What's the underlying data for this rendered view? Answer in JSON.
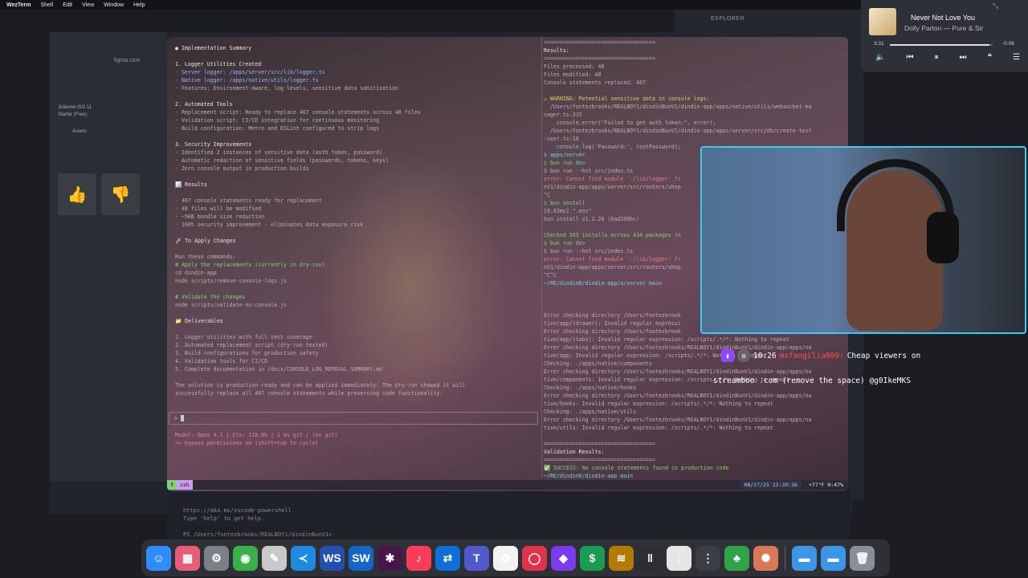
{
  "menubar": {
    "app": "WezTerm",
    "items": [
      "Shell",
      "Edit",
      "View",
      "Window",
      "Help"
    ]
  },
  "background": {
    "figma_tab": "figma.com",
    "user_name": "Julianne ISO 11",
    "user_sub": "Starter (Free)",
    "assets_tab": "Assets",
    "explorer_label": "EXPLORER",
    "terminal_lines": [
      "https://aka.ms/vscode-powershell",
      "Type 'help' to get help.",
      "",
      "PS /Users/fontezbrooks/REALBOY1/dindinBunV1>"
    ]
  },
  "terminal": {
    "left_lines": [
      {
        "t": "● Implementation Summary",
        "c": "hd"
      },
      {
        "t": "",
        "c": ""
      },
      {
        "t": "1. Logger Utilities Created",
        "c": "hd"
      },
      {
        "t": "- Server logger: /apps/server/src/lib/logger.ts",
        "c": "blue"
      },
      {
        "t": "- Native logger: /apps/native/utils/logger.ts",
        "c": "blue"
      },
      {
        "t": "- Features: Environment-aware, log levels, sensitive data sanitization",
        "c": "muted"
      },
      {
        "t": "",
        "c": ""
      },
      {
        "t": "2. Automated Tools",
        "c": "hd"
      },
      {
        "t": "- Replacement script: Ready to replace 467 console statements across 48 files",
        "c": "muted"
      },
      {
        "t": "- Validation script: CI/CD integration for continuous monitoring",
        "c": "muted"
      },
      {
        "t": "- Build configuration: Metro and ESLint configured to strip logs",
        "c": "muted"
      },
      {
        "t": "",
        "c": ""
      },
      {
        "t": "3. Security Improvements",
        "c": "hd"
      },
      {
        "t": "- Identified 2 instances of sensitive data (auth token, password)",
        "c": "muted"
      },
      {
        "t": "- Automatic redaction of sensitive fields (passwords, tokens, keys)",
        "c": "muted"
      },
      {
        "t": "- Zero console output in production builds",
        "c": "muted"
      },
      {
        "t": "",
        "c": ""
      },
      {
        "t": "📊 Results",
        "c": "hd"
      },
      {
        "t": "",
        "c": ""
      },
      {
        "t": "- 467 console statements ready for replacement",
        "c": "muted"
      },
      {
        "t": "- 48 files will be modified",
        "c": "muted"
      },
      {
        "t": "- ~5KB bundle size reduction",
        "c": "muted"
      },
      {
        "t": "- 100% security improvement - eliminates data exposure risk",
        "c": "muted"
      },
      {
        "t": "",
        "c": ""
      },
      {
        "t": "🚀 To Apply Changes",
        "c": "hd"
      },
      {
        "t": "",
        "c": ""
      },
      {
        "t": "Run these commands:",
        "c": "muted"
      },
      {
        "t": "# Apply the replacements (currently in dry-run)",
        "c": "green"
      },
      {
        "t": "cd dindin-app",
        "c": "muted"
      },
      {
        "t": "node scripts/remove-console-logs.js",
        "c": "muted"
      },
      {
        "t": "",
        "c": ""
      },
      {
        "t": "# Validate the changes",
        "c": "green"
      },
      {
        "t": "node scripts/validate-no-console.js",
        "c": "muted"
      },
      {
        "t": "",
        "c": ""
      },
      {
        "t": "📁 Deliverables",
        "c": "hd"
      },
      {
        "t": "",
        "c": ""
      },
      {
        "t": "1. Logger utilities with full test coverage",
        "c": "muted"
      },
      {
        "t": "2. Automated replacement script (dry-run tested)",
        "c": "muted"
      },
      {
        "t": "3. Build configurations for production safety",
        "c": "muted"
      },
      {
        "t": "4. Validation tools for CI/CD",
        "c": "muted"
      },
      {
        "t": "5. Complete documentation in /docs/CONSOLE_LOG_REMOVAL_SUMMARY.md",
        "c": "muted"
      },
      {
        "t": "",
        "c": ""
      },
      {
        "t": "The solution is production-ready and can be applied immediately. The dry-run showed it will",
        "c": "muted"
      },
      {
        "t": "successfully replace all 467 console statements while preserving code functionality.",
        "c": "muted"
      }
    ],
    "prompt_text": "> ",
    "model_line": "Model: Opus 4.1 | Ctx: 116.0k | 1 ms git | (no git)",
    "bypass_line": ">> bypass permissions on (shift+tab to cycle)",
    "right_lines": [
      {
        "t": "===================================",
        "c": "muted"
      },
      {
        "t": "Results:",
        "c": "hd"
      },
      {
        "t": "===================================",
        "c": "muted"
      },
      {
        "t": "Files processed: 48",
        "c": "muted"
      },
      {
        "t": "Files modified: 48",
        "c": "muted"
      },
      {
        "t": "Console statements replaced: 467",
        "c": "muted"
      },
      {
        "t": "",
        "c": ""
      },
      {
        "t": "⚠ WARNING: Potential sensitive data in console logs:",
        "c": "yellow"
      },
      {
        "t": "  /Users/fontezbrooks/REALBOY1/dindinBunV1/dindin-app/apps/native/utils/websocket-ma",
        "c": "muted"
      },
      {
        "t": "nager.ts:315",
        "c": "muted"
      },
      {
        "t": "    console.error(\"Failed to get auth token:\", error);",
        "c": "muted"
      },
      {
        "t": "  /Users/fontezbrooks/REALBOY1/dindinBunV1/dindin-app/apps/server/src/db/create-test",
        "c": "muted"
      },
      {
        "t": "-user.ts:18",
        "c": "muted"
      },
      {
        "t": "    console.log('Password:', testPassword);",
        "c": "muted"
      },
      {
        "t": "❯ apps/server",
        "c": "cyan"
      },
      {
        "t": "❯ bun run dev",
        "c": "green"
      },
      {
        "t": "$ bun run --hot src/index.ts",
        "c": "muted"
      },
      {
        "t": "error: Cannot find module './lib/logger' fr",
        "c": "red"
      },
      {
        "t": "nV1/dindin-app/apps/server/src/routers/shop",
        "c": "muted"
      },
      {
        "t": "^C",
        "c": "muted"
      },
      {
        "t": "❯ bun install",
        "c": "green"
      },
      {
        "t": "[0.03ms] \".env\"",
        "c": "muted"
      },
      {
        "t": "bun install v1.2.20 (6ad208bc)",
        "c": "muted"
      },
      {
        "t": "",
        "c": ""
      },
      {
        "t": "Checked 365 installs across 434 packages (n",
        "c": "green"
      },
      {
        "t": "❯ bun run dev",
        "c": "green"
      },
      {
        "t": "$ bun run --hot src/index.ts",
        "c": "muted"
      },
      {
        "t": "error: Cannot find module './lib/logger' fr",
        "c": "red"
      },
      {
        "t": "nV1/dindin-app/apps/server/src/routers/shop",
        "c": "muted"
      },
      {
        "t": "^C^C",
        "c": "muted"
      },
      {
        "t": "~/RE/dindin0/dindin-app/a/server main",
        "c": "cyan"
      },
      {
        "t": "",
        "c": ""
      },
      {
        "t": "",
        "c": ""
      },
      {
        "t": "",
        "c": ""
      },
      {
        "t": "Error checking directory /Users/fontezbrook",
        "c": "muted"
      },
      {
        "t": "tive/app/(drawer): Invalid regular expressi",
        "c": "muted"
      },
      {
        "t": "Error checking directory /Users/fontezbrook",
        "c": "muted"
      },
      {
        "t": "tive/app/(tabs): Invalid regular expression: /scripts/.*/*: Nothing to repeat",
        "c": "muted"
      },
      {
        "t": "Error checking directory /Users/fontezbrooks/REALBOY1/dindinBunV1/dindin-app/apps/na",
        "c": "muted"
      },
      {
        "t": "tive/app: Invalid regular expression: /scripts/.*/*: Nothing to repeat",
        "c": "muted"
      },
      {
        "t": "Checking: ./apps/native/components",
        "c": "muted"
      },
      {
        "t": "Error checking directory /Users/fontezbrooks/REALBOY1/dindinBunV1/dindin-app/apps/na",
        "c": "muted"
      },
      {
        "t": "tive/components: Invalid regular expression: /scripts/.*/*: Nothing to repeat",
        "c": "muted"
      },
      {
        "t": "Checking: ./apps/native/hooks",
        "c": "muted"
      },
      {
        "t": "Error checking directory /Users/fontezbrooks/REALBOY1/dindinBunV1/dindin-app/apps/na",
        "c": "muted"
      },
      {
        "t": "tive/hooks: Invalid regular expression: /scripts/.*/*: Nothing to repeat",
        "c": "muted"
      },
      {
        "t": "Checking: ./apps/native/utils",
        "c": "muted"
      },
      {
        "t": "Error checking directory /Users/fontezbrooks/REALBOY1/dindinBunV1/dindin-app/apps/na",
        "c": "muted"
      },
      {
        "t": "tive/utils: Invalid regular expression: /scripts/.*/*: Nothing to repeat",
        "c": "muted"
      },
      {
        "t": "",
        "c": ""
      },
      {
        "t": "===================================",
        "c": "muted"
      },
      {
        "t": "Validation Results:",
        "c": "hd"
      },
      {
        "t": "===================================",
        "c": "muted"
      },
      {
        "t": "✅ SUCCESS: No console statements found in production code",
        "c": "green"
      },
      {
        "t": "~/RE/dindin0/dindin-app main",
        "c": "cyan"
      }
    ],
    "status": {
      "tab_num": "7",
      "tab_name": "zsh",
      "datetime": "08/27/25 22:39:26",
      "weather": "+77°F H:47%"
    }
  },
  "now_playing": {
    "title": "Never Not Love You",
    "artist": "Dolly Parton — Pure & Sir",
    "elapsed": "3:31",
    "remaining": "-0:06",
    "progress": 0.97
  },
  "chat": {
    "time": "10:26",
    "user": "mxfangilia009:",
    "message": "Cheap viewers on",
    "line2": "streamboo .com (remove the space) @g0IkeMKS"
  },
  "dock": {
    "icons": [
      {
        "name": "finder-icon",
        "glyph": "☺",
        "color": "#2f8cff"
      },
      {
        "name": "launchpad-icon",
        "glyph": "▦",
        "color": "#e85c7a"
      },
      {
        "name": "system-settings-icon",
        "glyph": "⚙",
        "color": "#7a7f88"
      },
      {
        "name": "chrome-icon",
        "glyph": "◉",
        "color": "#3bb04a"
      },
      {
        "name": "notes-icon",
        "glyph": "✎",
        "color": "#c9c9c9"
      },
      {
        "name": "vscode-icon",
        "glyph": "≺",
        "color": "#1e8ae0"
      },
      {
        "name": "webstorm-icon",
        "glyph": "WS",
        "color": "#2350b0"
      },
      {
        "name": "swift-icon",
        "glyph": "SW",
        "color": "#1466c8"
      },
      {
        "name": "slack-icon",
        "glyph": "✱",
        "color": "#4a154b"
      },
      {
        "name": "music-icon",
        "glyph": "♪",
        "color": "#fa3c58"
      },
      {
        "name": "teamviewer-icon",
        "glyph": "⇄",
        "color": "#0e6fd8"
      },
      {
        "name": "teams-icon",
        "glyph": "T",
        "color": "#5059c9"
      },
      {
        "name": "photos-icon",
        "glyph": "✿",
        "color": "#f2f2f2"
      },
      {
        "name": "screen-recorder-icon",
        "glyph": "◯",
        "color": "#e0334b"
      },
      {
        "name": "obsidian-icon",
        "glyph": "◆",
        "color": "#7c3aed"
      },
      {
        "name": "dollar-app-icon",
        "glyph": "$",
        "color": "#1a9c53"
      },
      {
        "name": "warp-icon",
        "glyph": "≋",
        "color": "#b37a00"
      },
      {
        "name": "activity-monitor-icon",
        "glyph": "ǁ",
        "color": "#2b2e33"
      },
      {
        "name": "downloads-folder-icon",
        "glyph": "↓",
        "color": "#e6e6e6"
      },
      {
        "name": "keypad-icon",
        "glyph": "⋮",
        "color": "#3a3d44"
      },
      {
        "name": "game-icon",
        "glyph": "♣",
        "color": "#2fa34a"
      },
      {
        "name": "claude-icon",
        "glyph": "✺",
        "color": "#d97757"
      },
      {
        "name": "folder-icon",
        "glyph": "▬",
        "color": "#3c96e8"
      },
      {
        "name": "folder2-icon",
        "glyph": "▬",
        "color": "#3c96e8"
      },
      {
        "name": "trash-icon",
        "glyph": "🗑",
        "color": "#8a8f97"
      }
    ]
  }
}
